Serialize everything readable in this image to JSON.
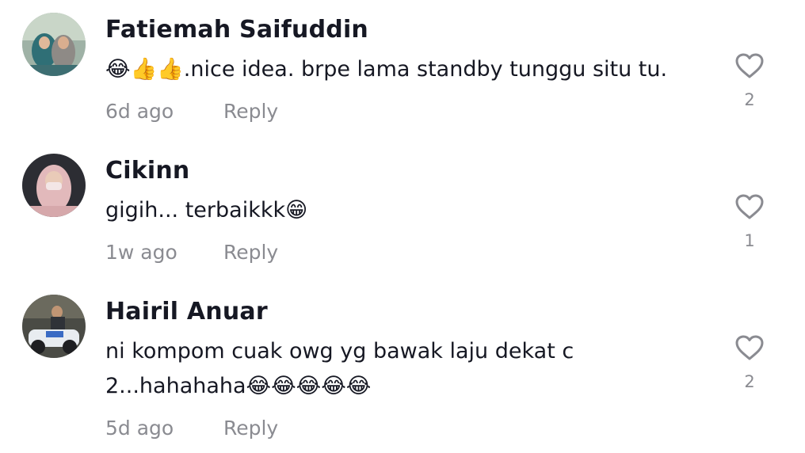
{
  "comments": [
    {
      "username": "Fatiemah Saifuddin",
      "text": "😂👍👍.nice idea. brpe lama standby tunggu situ tu.",
      "time": "6d ago",
      "reply_label": "Reply",
      "likes": "2"
    },
    {
      "username": "Cikinn",
      "text": "gigih... terbaikkk😁",
      "time": "1w ago",
      "reply_label": "Reply",
      "likes": "1"
    },
    {
      "username": "Hairil Anuar",
      "text": "ni kompom cuak owg yg bawak laju dekat c 2...hahahaha😂😂😂😂😂",
      "time": "5d ago",
      "reply_label": "Reply",
      "likes": "2"
    }
  ],
  "icons": {
    "like": "heart-outline-icon"
  },
  "colors": {
    "text": "#161823",
    "secondary": "#8a8b91"
  }
}
